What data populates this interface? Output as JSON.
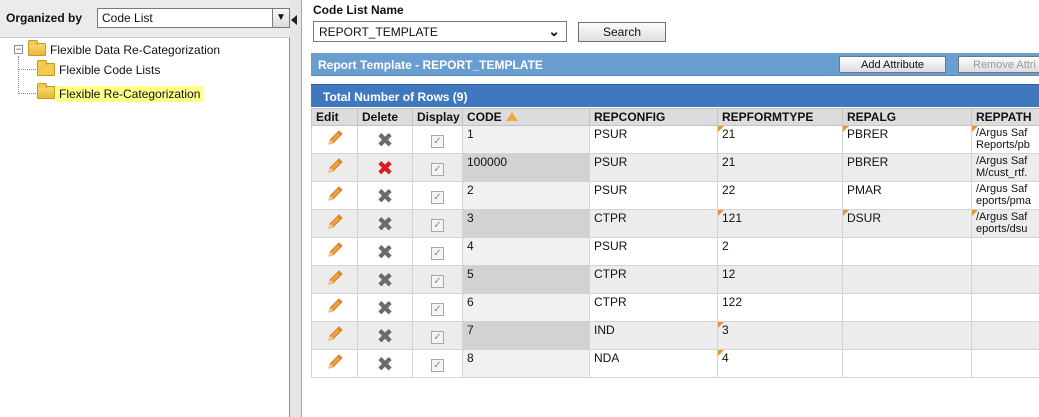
{
  "left_panel": {
    "organized_by_label": "Organized by",
    "organized_by_value": "Code List",
    "tree": {
      "root": "Flexible Data Re-Categorization",
      "child_1": "Flexible Code Lists",
      "child_2": "Flexible Re-Categorization"
    }
  },
  "code_list": {
    "label": "Code List Name",
    "value": "REPORT_TEMPLATE",
    "search_label": "Search"
  },
  "section": {
    "title": "Report Template - REPORT_TEMPLATE",
    "add_attribute_label": "Add Attribute",
    "remove_attribute_label": "Remove Attri"
  },
  "rows_bar": {
    "title": "Total Number of Rows (9)"
  },
  "table": {
    "headers": {
      "edit": "Edit",
      "delete": "Delete",
      "display": "Display",
      "code": "CODE",
      "repconfig": "REPCONFIG",
      "repformtype": "REPFORMTYPE",
      "repalg": "REPALG",
      "reppath": "REPPATH"
    },
    "rows": [
      {
        "code": "1",
        "repconfig": "PSUR",
        "repformtype": "21",
        "repalg": "PBRER",
        "reppath_1": "/Argus Saf",
        "reppath_2": "Reports/pb"
      },
      {
        "code": "100000",
        "repconfig": "PSUR",
        "repformtype": "21",
        "repalg": "PBRER",
        "reppath_1": "/Argus Saf",
        "reppath_2": "M/cust_rtf."
      },
      {
        "code": "2",
        "repconfig": "PSUR",
        "repformtype": "22",
        "repalg": "PMAR",
        "reppath_1": "/Argus Saf",
        "reppath_2": "eports/pma"
      },
      {
        "code": "3",
        "repconfig": "CTPR",
        "repformtype": "121",
        "repalg": "DSUR",
        "reppath_1": "/Argus Saf",
        "reppath_2": "eports/dsu"
      },
      {
        "code": "4",
        "repconfig": "PSUR",
        "repformtype": "2",
        "repalg": "",
        "reppath_1": "",
        "reppath_2": ""
      },
      {
        "code": "5",
        "repconfig": "CTPR",
        "repformtype": "12",
        "repalg": "",
        "reppath_1": "",
        "reppath_2": ""
      },
      {
        "code": "6",
        "repconfig": "CTPR",
        "repformtype": "122",
        "repalg": "",
        "reppath_1": "",
        "reppath_2": ""
      },
      {
        "code": "7",
        "repconfig": "IND",
        "repformtype": "3",
        "repalg": "",
        "reppath_1": "",
        "reppath_2": ""
      },
      {
        "code": "8",
        "repconfig": "NDA",
        "repformtype": "4",
        "repalg": "",
        "reppath_1": "",
        "reppath_2": ""
      }
    ]
  },
  "colors": {
    "section_header": "#6a9ed1",
    "rows_bar": "#3f78bf",
    "highlight": "#ffff8a",
    "delete_red": "#d62020",
    "edit_pencil": "#e8942c"
  },
  "icons": {
    "edit": "pencil-icon",
    "delete": "x-icon",
    "display": "checkbox-checked",
    "sort": "sort-ascending-icon",
    "folder": "folder-icon"
  }
}
